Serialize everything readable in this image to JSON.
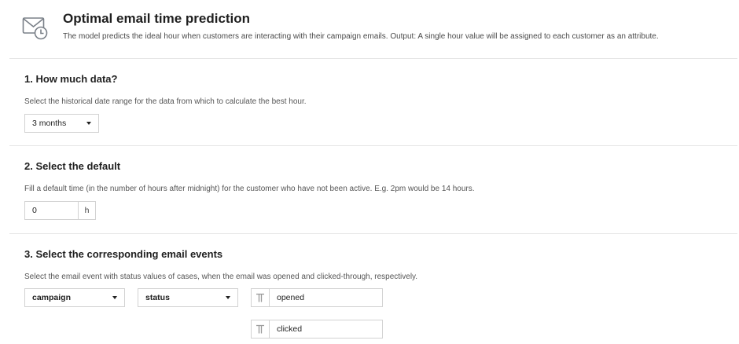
{
  "header": {
    "title": "Optimal email time prediction",
    "description": "The model predicts the ideal hour when customers are interacting with their campaign emails. Output: A single hour value will be assigned to each customer as an attribute.",
    "icon": "email-clock-icon"
  },
  "sections": [
    {
      "title": "1. How much data?",
      "description": "Select the historical date range for the data from which to calculate the best hour.",
      "range_select": {
        "value": "3 months"
      }
    },
    {
      "title": "2. Select the default",
      "description": "Fill a default time (in the number of hours after midnight) for the customer who have not been active. E.g. 2pm would be 14 hours.",
      "default_hour": {
        "value": "0",
        "unit": "h"
      }
    },
    {
      "title": "3. Select the corresponding email events",
      "description": "Select the email event with status values of cases, when the email was opened and clicked-through, respectively.",
      "event_select": {
        "value": "campaign"
      },
      "property_select": {
        "value": "status"
      },
      "opened_value": "opened",
      "clicked_value": "clicked"
    }
  ],
  "colors": {
    "icon_gray": "#7a8088",
    "border": "#d2d2d2",
    "divider": "#e6e6e6"
  }
}
